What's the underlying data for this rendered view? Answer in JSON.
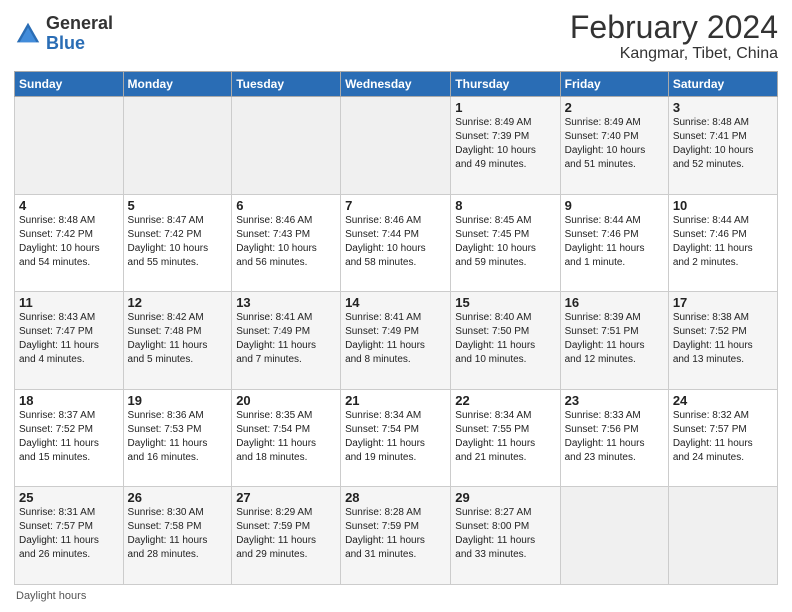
{
  "logo": {
    "general": "General",
    "blue": "Blue"
  },
  "title": "February 2024",
  "subtitle": "Kangmar, Tibet, China",
  "days_header": [
    "Sunday",
    "Monday",
    "Tuesday",
    "Wednesday",
    "Thursday",
    "Friday",
    "Saturday"
  ],
  "footer": "Daylight hours",
  "weeks": [
    [
      {
        "num": "",
        "info": ""
      },
      {
        "num": "",
        "info": ""
      },
      {
        "num": "",
        "info": ""
      },
      {
        "num": "",
        "info": ""
      },
      {
        "num": "1",
        "info": "Sunrise: 8:49 AM\nSunset: 7:39 PM\nDaylight: 10 hours\nand 49 minutes."
      },
      {
        "num": "2",
        "info": "Sunrise: 8:49 AM\nSunset: 7:40 PM\nDaylight: 10 hours\nand 51 minutes."
      },
      {
        "num": "3",
        "info": "Sunrise: 8:48 AM\nSunset: 7:41 PM\nDaylight: 10 hours\nand 52 minutes."
      }
    ],
    [
      {
        "num": "4",
        "info": "Sunrise: 8:48 AM\nSunset: 7:42 PM\nDaylight: 10 hours\nand 54 minutes."
      },
      {
        "num": "5",
        "info": "Sunrise: 8:47 AM\nSunset: 7:42 PM\nDaylight: 10 hours\nand 55 minutes."
      },
      {
        "num": "6",
        "info": "Sunrise: 8:46 AM\nSunset: 7:43 PM\nDaylight: 10 hours\nand 56 minutes."
      },
      {
        "num": "7",
        "info": "Sunrise: 8:46 AM\nSunset: 7:44 PM\nDaylight: 10 hours\nand 58 minutes."
      },
      {
        "num": "8",
        "info": "Sunrise: 8:45 AM\nSunset: 7:45 PM\nDaylight: 10 hours\nand 59 minutes."
      },
      {
        "num": "9",
        "info": "Sunrise: 8:44 AM\nSunset: 7:46 PM\nDaylight: 11 hours\nand 1 minute."
      },
      {
        "num": "10",
        "info": "Sunrise: 8:44 AM\nSunset: 7:46 PM\nDaylight: 11 hours\nand 2 minutes."
      }
    ],
    [
      {
        "num": "11",
        "info": "Sunrise: 8:43 AM\nSunset: 7:47 PM\nDaylight: 11 hours\nand 4 minutes."
      },
      {
        "num": "12",
        "info": "Sunrise: 8:42 AM\nSunset: 7:48 PM\nDaylight: 11 hours\nand 5 minutes."
      },
      {
        "num": "13",
        "info": "Sunrise: 8:41 AM\nSunset: 7:49 PM\nDaylight: 11 hours\nand 7 minutes."
      },
      {
        "num": "14",
        "info": "Sunrise: 8:41 AM\nSunset: 7:49 PM\nDaylight: 11 hours\nand 8 minutes."
      },
      {
        "num": "15",
        "info": "Sunrise: 8:40 AM\nSunset: 7:50 PM\nDaylight: 11 hours\nand 10 minutes."
      },
      {
        "num": "16",
        "info": "Sunrise: 8:39 AM\nSunset: 7:51 PM\nDaylight: 11 hours\nand 12 minutes."
      },
      {
        "num": "17",
        "info": "Sunrise: 8:38 AM\nSunset: 7:52 PM\nDaylight: 11 hours\nand 13 minutes."
      }
    ],
    [
      {
        "num": "18",
        "info": "Sunrise: 8:37 AM\nSunset: 7:52 PM\nDaylight: 11 hours\nand 15 minutes."
      },
      {
        "num": "19",
        "info": "Sunrise: 8:36 AM\nSunset: 7:53 PM\nDaylight: 11 hours\nand 16 minutes."
      },
      {
        "num": "20",
        "info": "Sunrise: 8:35 AM\nSunset: 7:54 PM\nDaylight: 11 hours\nand 18 minutes."
      },
      {
        "num": "21",
        "info": "Sunrise: 8:34 AM\nSunset: 7:54 PM\nDaylight: 11 hours\nand 19 minutes."
      },
      {
        "num": "22",
        "info": "Sunrise: 8:34 AM\nSunset: 7:55 PM\nDaylight: 11 hours\nand 21 minutes."
      },
      {
        "num": "23",
        "info": "Sunrise: 8:33 AM\nSunset: 7:56 PM\nDaylight: 11 hours\nand 23 minutes."
      },
      {
        "num": "24",
        "info": "Sunrise: 8:32 AM\nSunset: 7:57 PM\nDaylight: 11 hours\nand 24 minutes."
      }
    ],
    [
      {
        "num": "25",
        "info": "Sunrise: 8:31 AM\nSunset: 7:57 PM\nDaylight: 11 hours\nand 26 minutes."
      },
      {
        "num": "26",
        "info": "Sunrise: 8:30 AM\nSunset: 7:58 PM\nDaylight: 11 hours\nand 28 minutes."
      },
      {
        "num": "27",
        "info": "Sunrise: 8:29 AM\nSunset: 7:59 PM\nDaylight: 11 hours\nand 29 minutes."
      },
      {
        "num": "28",
        "info": "Sunrise: 8:28 AM\nSunset: 7:59 PM\nDaylight: 11 hours\nand 31 minutes."
      },
      {
        "num": "29",
        "info": "Sunrise: 8:27 AM\nSunset: 8:00 PM\nDaylight: 11 hours\nand 33 minutes."
      },
      {
        "num": "",
        "info": ""
      },
      {
        "num": "",
        "info": ""
      }
    ]
  ]
}
